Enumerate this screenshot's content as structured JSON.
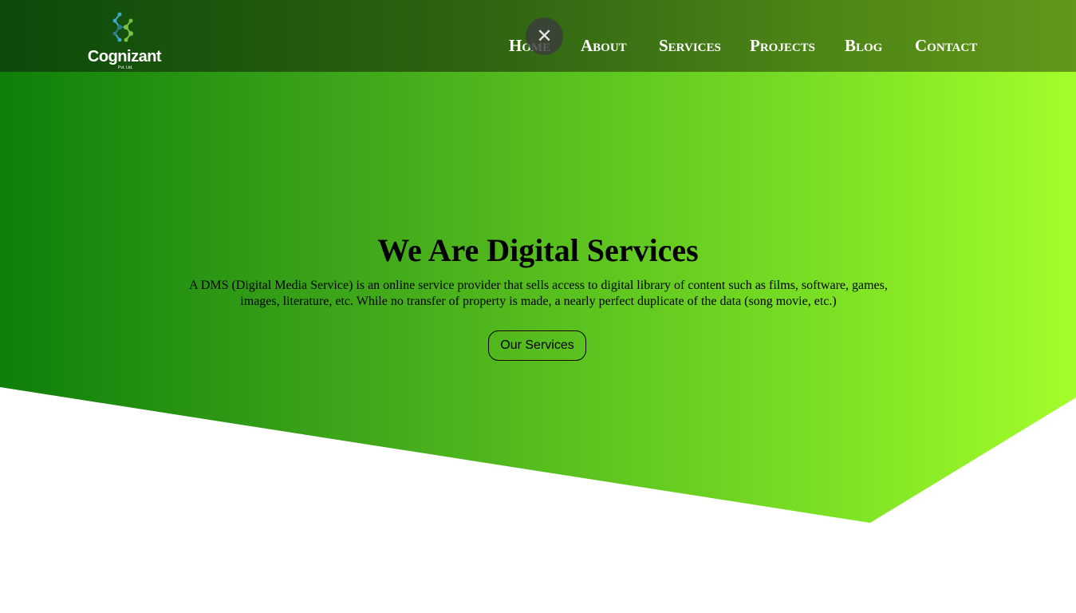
{
  "brand": {
    "name": "Cognizant",
    "sub": "Pvt. Ltd.",
    "logo_icon": "molecule-icon",
    "logo_colors": [
      "#3fa8c8",
      "#7cc242",
      "#2e7d8f"
    ]
  },
  "nav": {
    "items": [
      {
        "label": "Home"
      },
      {
        "label": "About"
      },
      {
        "label": "Services"
      },
      {
        "label": "Projects"
      },
      {
        "label": "Blog"
      },
      {
        "label": "Contact"
      }
    ]
  },
  "overlay": {
    "close_icon": "close-icon",
    "close_glyph": "✕"
  },
  "hero": {
    "title": "We Are Digital Services",
    "description": "A DMS (Digital Media Service) is an online service provider that sells access to digital library of content such as films, software, games, images, literature, etc. While no transfer of property is made, a nearly perfect duplicate of the data (song movie, etc.)",
    "cta_label": "Our Services"
  },
  "colors": {
    "hero_gradient_start": "#0f7f0a",
    "hero_gradient_end": "#a4fd2a",
    "navbar_start": "#0b4a09",
    "navbar_end": "#63981a",
    "text": "#000000"
  }
}
